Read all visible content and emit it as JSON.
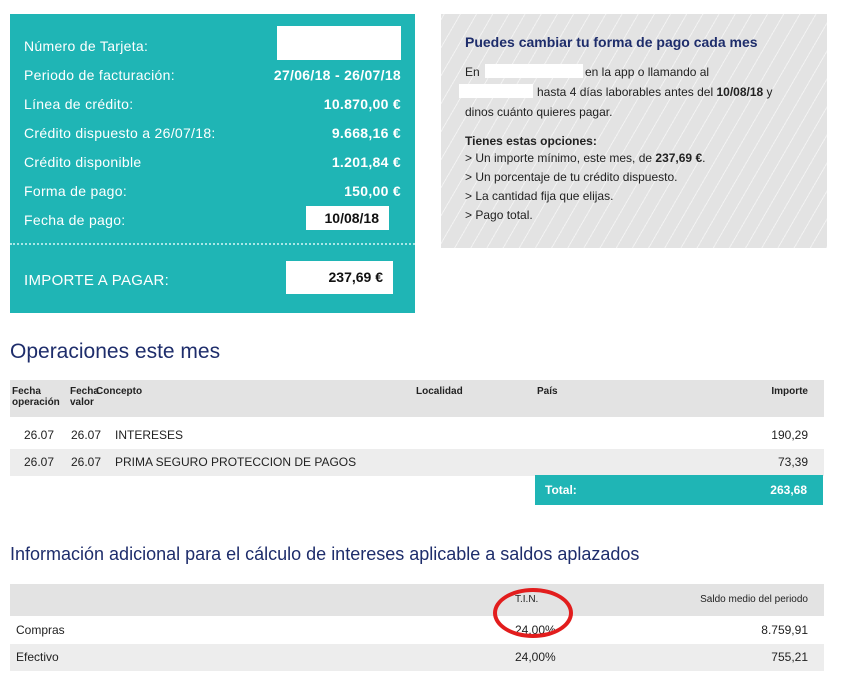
{
  "summary": {
    "rows": [
      {
        "label": "Número de Tarjeta:",
        "value": ""
      },
      {
        "label": "Periodo de facturación:",
        "value": "27/06/18 - 26/07/18"
      },
      {
        "label": "Línea de crédito:",
        "value": "10.870,00 €"
      },
      {
        "label": "Crédito dispuesto a 26/07/18:",
        "value": "9.668,16 €"
      },
      {
        "label": "Crédito disponible",
        "value": "1.201,84 €"
      },
      {
        "label": "Forma de pago:",
        "value": "150,00 €"
      },
      {
        "label": "Fecha de pago:",
        "value": "10/08/18"
      }
    ],
    "importe_label": "IMPORTE A PAGAR:",
    "importe_value": "237,69 €",
    "colors": {
      "teal": "#1fb5b5"
    }
  },
  "info": {
    "title": "Puedes cambiar tu forma de pago cada mes",
    "l1a": "En",
    "l1b": "en la app o llamando al",
    "l2a": "hasta 4 días laborables antes del ",
    "l2date": "10/08/18",
    "l2b": " y",
    "l3": "dinos cuánto quieres pagar.",
    "options_title": "Tienes estas opciones:",
    "o1a": "> Un importe mínimo, este mes, de ",
    "o1val": "237,69 €",
    "o1b": ".",
    "o2": "> Un porcentaje de tu crédito dispuesto.",
    "o3": "> La cantidad fija que elijas.",
    "o4": "> Pago total."
  },
  "operations": {
    "title": "Operaciones este mes",
    "headers": {
      "fecha_op_1": "Fecha",
      "fecha_op_2": "operación",
      "fecha_val_1": "Fecha",
      "fecha_val_2": "valor",
      "concepto": "Concepto",
      "localidad": "Localidad",
      "pais": "País",
      "importe": "Importe"
    },
    "rows": [
      {
        "fop": "26.07",
        "fval": "26.07",
        "concepto": "INTERESES",
        "importe": "190,29"
      },
      {
        "fop": "26.07",
        "fval": "26.07",
        "concepto": "PRIMA SEGURO PROTECCION DE PAGOS",
        "importe": "73,39"
      }
    ],
    "total_label": "Total:",
    "total_value": "263,68"
  },
  "interest": {
    "title": "Información adicional para el cálculo de intereses aplicable a saldos aplazados",
    "headers": {
      "tin": "T.I.N.",
      "saldo": "Saldo medio del periodo"
    },
    "rows": [
      {
        "label": "Compras",
        "tin": "24,00%",
        "saldo": "8.759,91"
      },
      {
        "label": "Efectivo",
        "tin": "24,00%",
        "saldo": "755,21"
      }
    ],
    "highlight_color": "#e21d1d"
  }
}
